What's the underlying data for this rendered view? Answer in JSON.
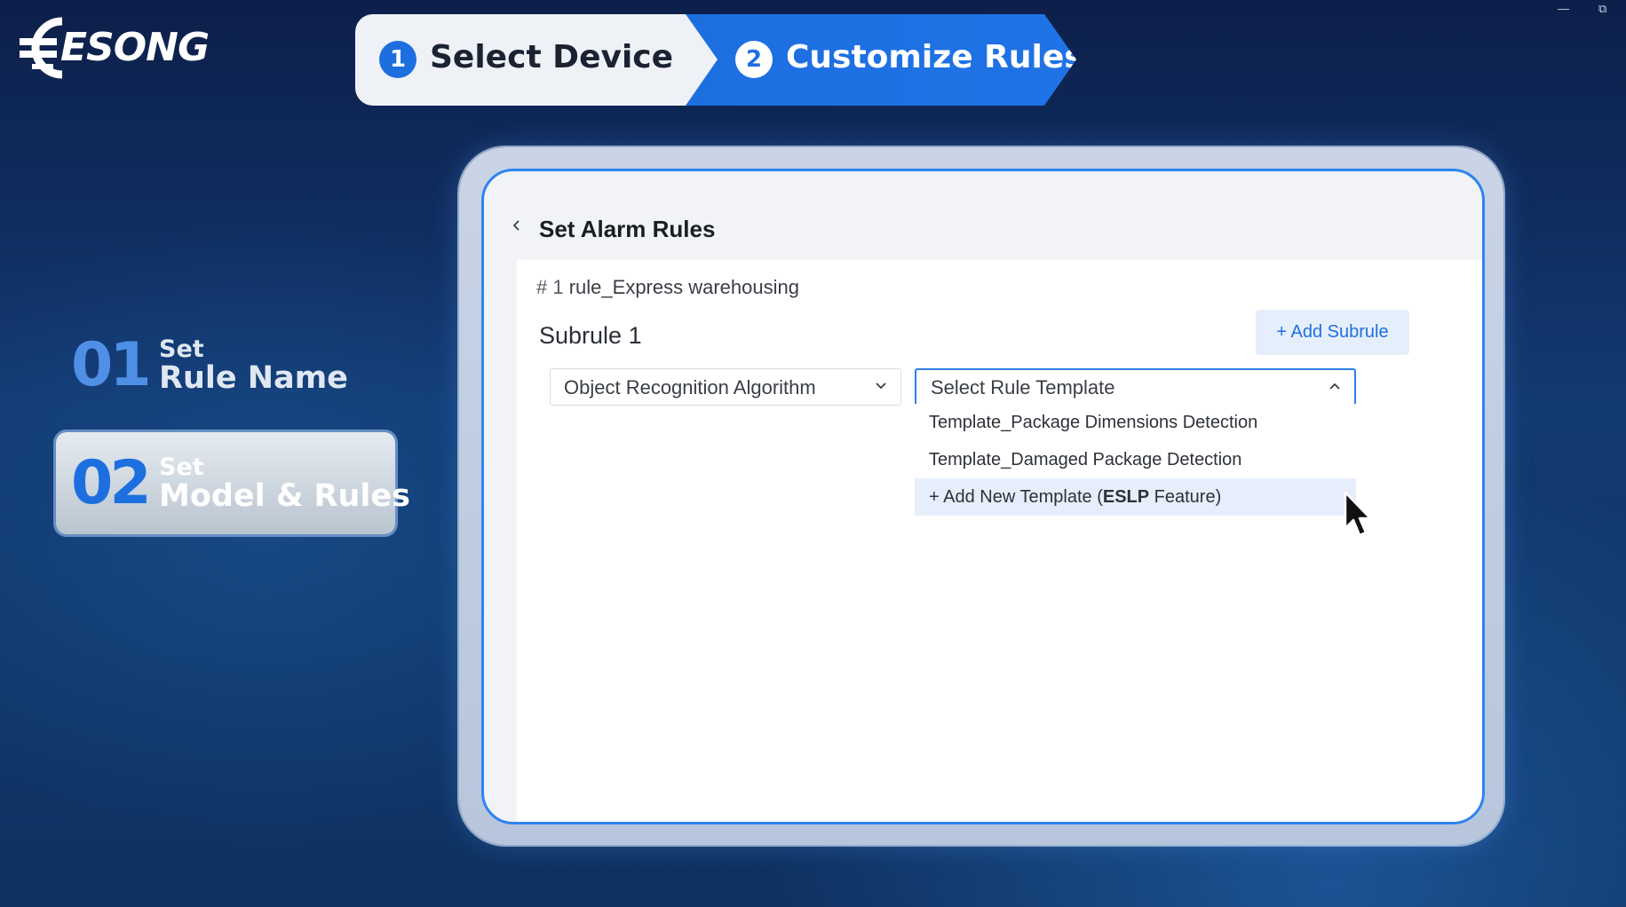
{
  "window": {
    "minimize_glyph": "—",
    "restore_glyph": "⧉"
  },
  "brand": {
    "logo_text": "ESONG"
  },
  "stepper": {
    "steps": [
      {
        "number": "1",
        "label": "Select Device"
      },
      {
        "number": "2",
        "label": "Customize Rules"
      }
    ]
  },
  "side_steps": [
    {
      "number": "01",
      "set": "Set",
      "title": "Rule Name"
    },
    {
      "number": "02",
      "set": "Set",
      "title": "Model & Rules"
    }
  ],
  "panel": {
    "title": "Set Alarm Rules",
    "rule_hash": "# 1",
    "rule_name": "rule_Express warehousing",
    "subrule_title": "Subrule 1",
    "add_subrule_label": "+ Add Subrule",
    "algorithm_select": {
      "value": "Object Recognition Algorithm"
    },
    "template_select": {
      "placeholder": "Select Rule Template",
      "open": true,
      "options": [
        "Template_Package Dimensions Detection",
        "Template_Damaged Package Detection"
      ],
      "add_new": {
        "prefix": "+ Add New Template  (",
        "bold": "ESLP",
        "suffix": " Feature)"
      }
    }
  },
  "colors": {
    "accent": "#1d6fe0",
    "background_dark": "#0d1f4a",
    "hover_row": "#e6eefb"
  }
}
